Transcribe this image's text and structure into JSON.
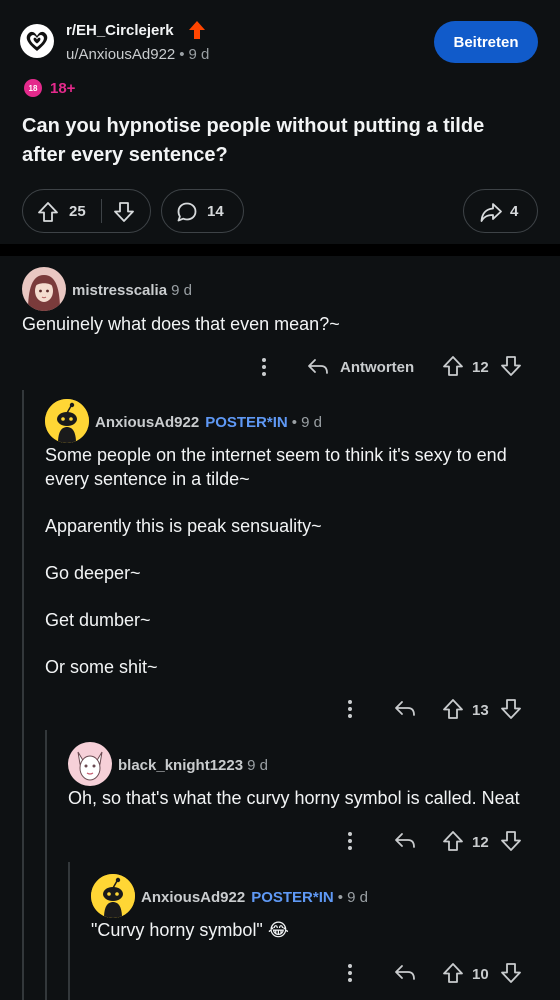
{
  "post": {
    "subreddit": "r/EH_Circlejerk",
    "author": "u/AnxiousAd922",
    "age": "9 d",
    "join_label": "Beitreten",
    "nsfw_badge": "18",
    "nsfw_label": "18+",
    "title": "Can you hypnotise people without putting a tilde after every sentence?",
    "upvotes": "25",
    "comments": "14",
    "shares": "4"
  },
  "comments": [
    {
      "author": "mistresscalia",
      "age": "9 d",
      "body": "Genuinely what does that even mean?~",
      "reply_label": "Antworten",
      "score": "12"
    },
    {
      "author": "AnxiousAd922",
      "op_label": "POSTER*IN",
      "age": "• 9 d",
      "body": "Some people on the internet seem to think it's sexy to end every sentence in a tilde~\n\nApparently this is peak sensuality~\n\nGo deeper~\n\nGet dumber~\n\nOr some shit~",
      "score": "13"
    },
    {
      "author": "black_knight1223",
      "age": "9 d",
      "body": "Oh, so that's what the curvy horny symbol is called. Neat",
      "score": "12"
    },
    {
      "author": "AnxiousAd922",
      "op_label": "POSTER*IN",
      "age": "• 9 d",
      "body": "\"Curvy horny symbol\" 😂",
      "score": "10"
    }
  ],
  "colors": {
    "background": "#0e1113",
    "join_button": "#115bca",
    "nsfw": "#e42a8c",
    "op_label": "#5f99f5",
    "upvote_arrow": "#ff4500"
  }
}
